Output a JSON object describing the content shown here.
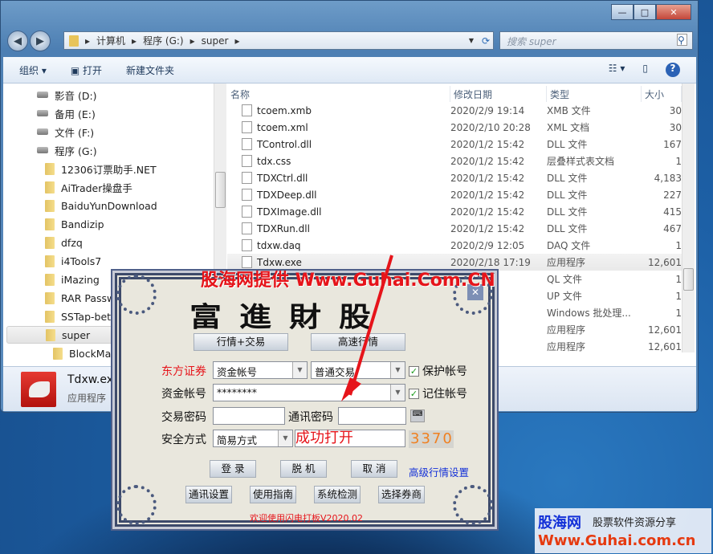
{
  "explorer": {
    "breadcrumb": [
      "计算机",
      "程序 (G:)",
      "super"
    ],
    "search_placeholder": "搜索 super",
    "toolbar": {
      "organize": "组织 ▾",
      "open": "打开",
      "new_folder": "新建文件夹"
    },
    "tree": [
      {
        "label": "影音 (D:)",
        "type": "drive"
      },
      {
        "label": "备用 (E:)",
        "type": "drive"
      },
      {
        "label": "文件 (F:)",
        "type": "drive"
      },
      {
        "label": "程序 (G:)",
        "type": "drive"
      },
      {
        "label": "12306订票助手.NET",
        "type": "folder"
      },
      {
        "label": "AiTrader操盘手",
        "type": "folder"
      },
      {
        "label": "BaiduYunDownload",
        "type": "folder"
      },
      {
        "label": "Bandizip",
        "type": "folder"
      },
      {
        "label": "dfzq",
        "type": "folder"
      },
      {
        "label": "i4Tools7",
        "type": "folder"
      },
      {
        "label": "iMazing",
        "type": "folder"
      },
      {
        "label": "RAR Passw",
        "type": "folder"
      },
      {
        "label": "SSTap-beta",
        "type": "folder"
      },
      {
        "label": "super",
        "type": "folder",
        "selected": true
      },
      {
        "label": "BlockMap",
        "type": "folder"
      }
    ],
    "columns": [
      "名称",
      "修改日期",
      "类型",
      "大小"
    ],
    "files": [
      {
        "name": "tcoem.xmb",
        "date": "2020/2/9 19:14",
        "type": "XMB 文件",
        "size": "30"
      },
      {
        "name": "tcoem.xml",
        "date": "2020/2/10 20:28",
        "type": "XML 文档",
        "size": "30"
      },
      {
        "name": "TControl.dll",
        "date": "2020/1/2 15:42",
        "type": "DLL 文件",
        "size": "167"
      },
      {
        "name": "tdx.css",
        "date": "2020/1/2 15:42",
        "type": "层叠样式表文档",
        "size": "1"
      },
      {
        "name": "TDXCtrl.dll",
        "date": "2020/1/2 15:42",
        "type": "DLL 文件",
        "size": "4,183"
      },
      {
        "name": "TDXDeep.dll",
        "date": "2020/1/2 15:42",
        "type": "DLL 文件",
        "size": "227"
      },
      {
        "name": "TDXImage.dll",
        "date": "2020/1/2 15:42",
        "type": "DLL 文件",
        "size": "415"
      },
      {
        "name": "TDXRun.dll",
        "date": "2020/1/2 15:42",
        "type": "DLL 文件",
        "size": "467"
      },
      {
        "name": "tdxw.daq",
        "date": "2020/2/9 12:05",
        "type": "DAQ 文件",
        "size": "1"
      },
      {
        "name": "Tdxw.exe",
        "date": "2020/2/18 17:19",
        "type": "应用程序",
        "size": "12,601"
      },
      {
        "name": "",
        "date": "15:42",
        "type": "QL 文件",
        "size": "1"
      },
      {
        "name": "",
        "date": "15:42",
        "type": "UP 文件",
        "size": "1"
      },
      {
        "name": "",
        "date": "15:42",
        "type": "Windows 批处理...",
        "size": "1"
      },
      {
        "name": "",
        "date": "6 10:52",
        "type": "应用程序",
        "size": "12,601"
      },
      {
        "name": "",
        "date": "6 10:11",
        "type": "应用程序",
        "size": "12,601"
      }
    ],
    "details": {
      "name": "Tdxw.exe",
      "type": "应用程序"
    }
  },
  "dialog": {
    "title_art": "富進財股",
    "btn_quote_trade": "行情+交易",
    "btn_fast_quote": "高速行情",
    "broker": "东方证券",
    "account_type": "资金帐号",
    "trade_type": "普通交易",
    "protect_account": "保护帐号",
    "remember_account": "记住帐号",
    "account_label": "资金帐号",
    "account_value": "********",
    "trade_pwd_label": "交易密码",
    "comm_pwd_label": "通讯密码",
    "security_label": "安全方式",
    "security_value": "简易方式",
    "success_text": "成功打开",
    "captcha": "3370",
    "login": "登 录",
    "offline": "脱 机",
    "cancel": "取 消",
    "advanced": "高级行情设置",
    "comm_settings": "通讯设置",
    "guide": "使用指南",
    "sys_check": "系统检测",
    "choose_broker": "选择券商",
    "welcome": "欢迎使用闪电打板V2020.02"
  },
  "watermark": {
    "top": "股海网提供 Www.Guhai.Com.CN",
    "banner_logo": "股海网",
    "banner_slogan": "股票软件资源分享",
    "banner_url": "Www.Guhai.com.cn"
  },
  "colors": {
    "red": "#e6141a",
    "blue": "#1330d8",
    "captcha": "#f08020"
  }
}
